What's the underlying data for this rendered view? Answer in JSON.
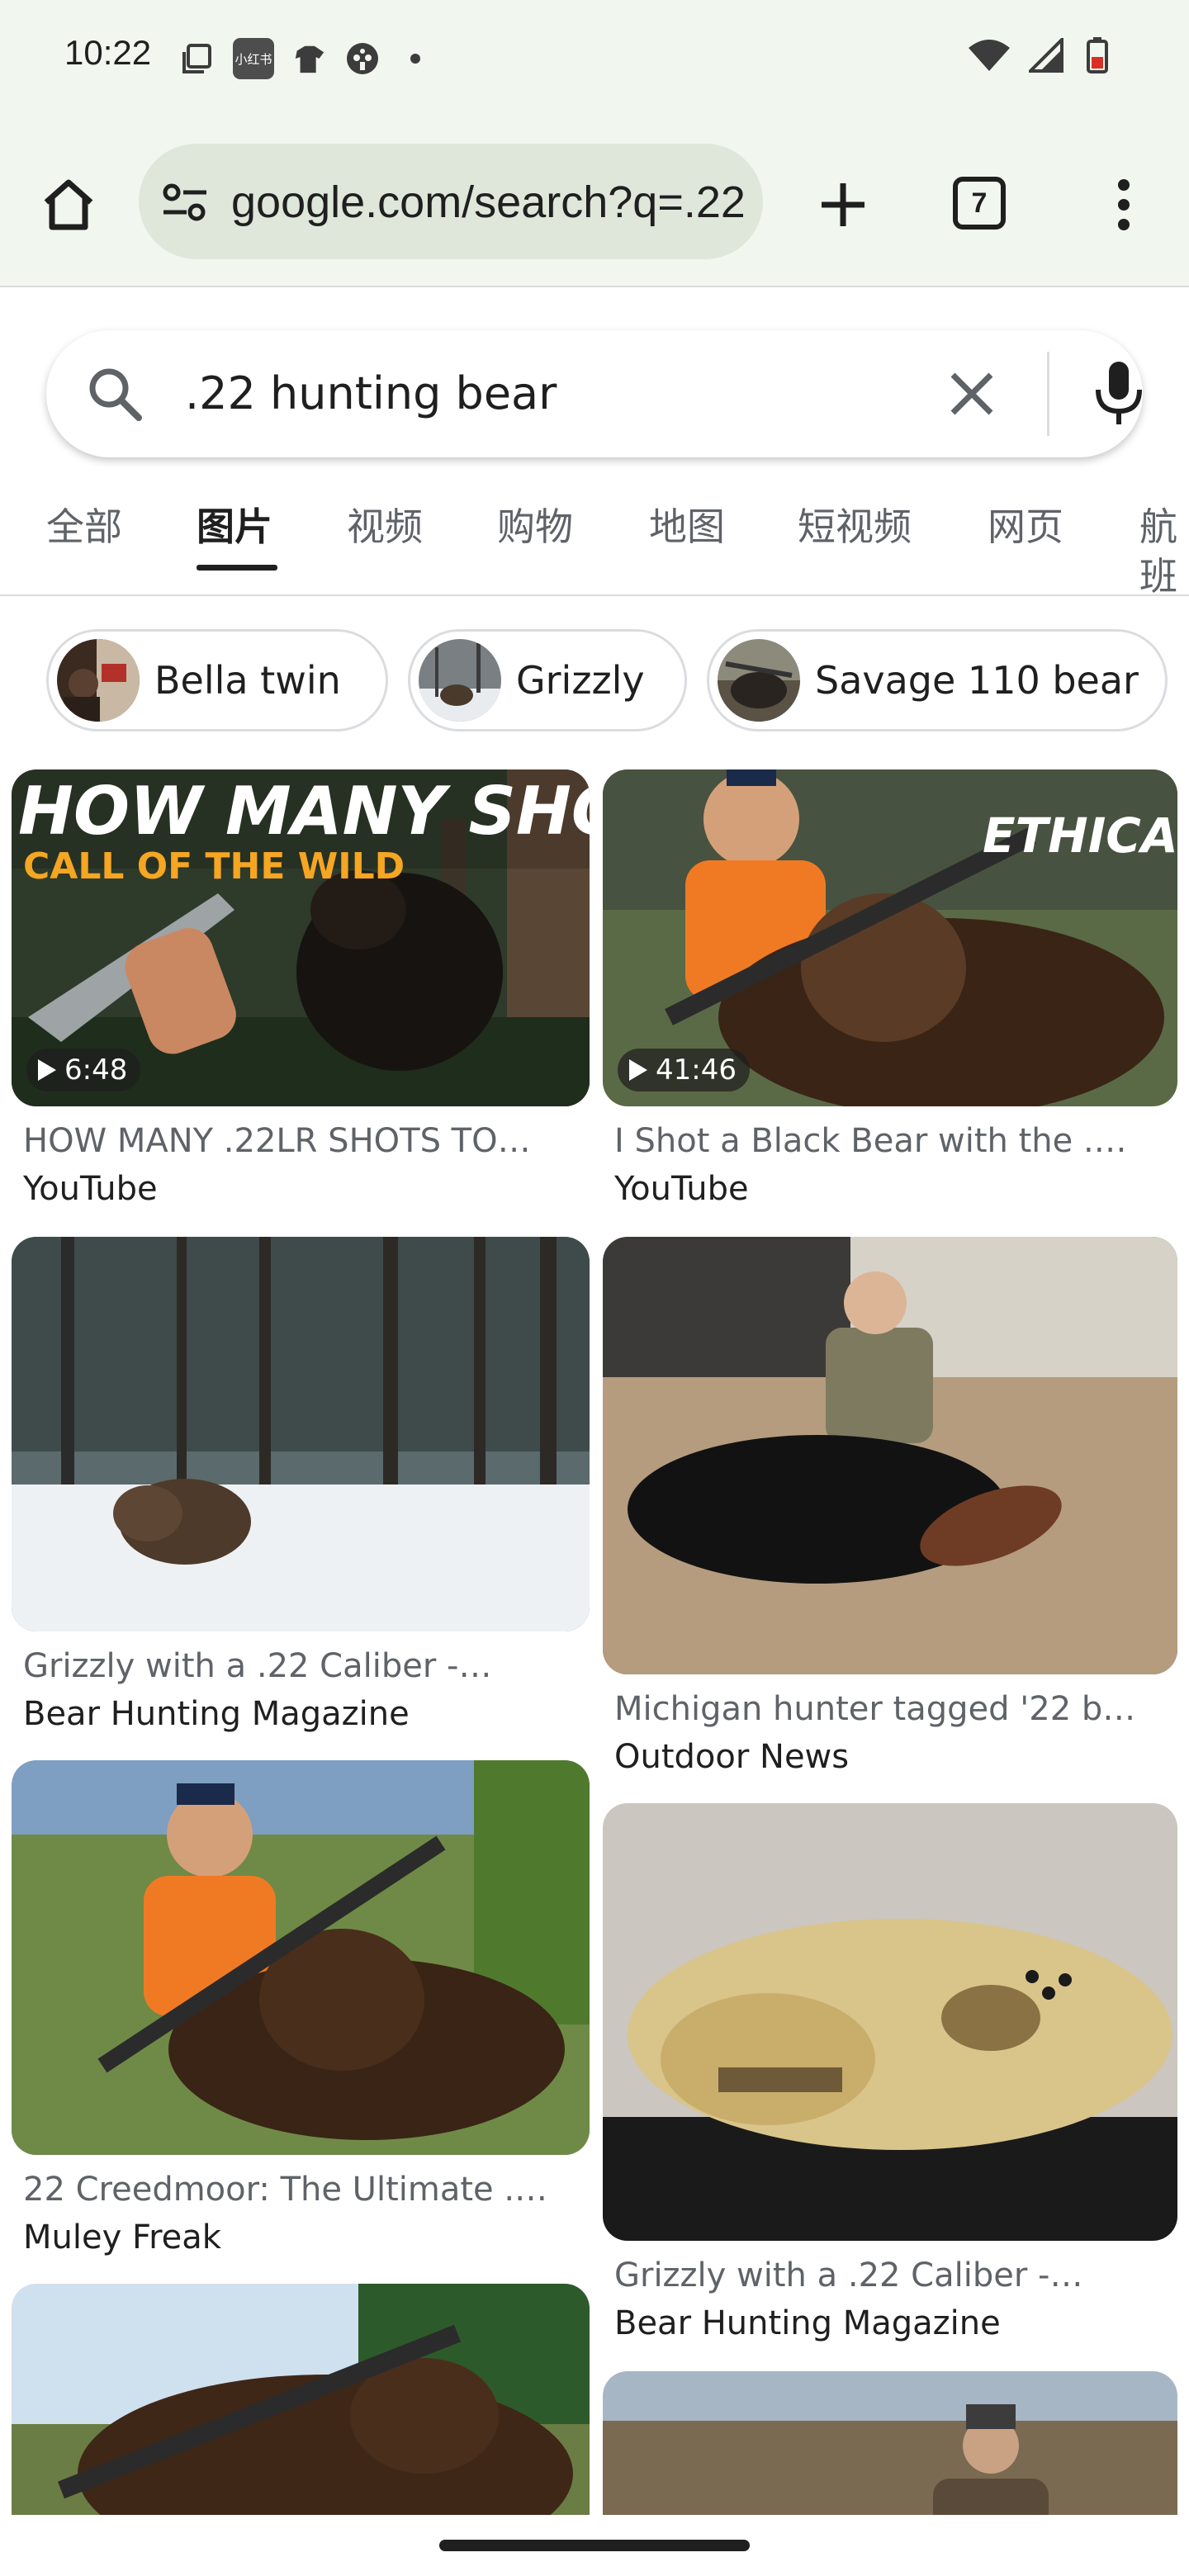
{
  "status_bar": {
    "time": "10:22",
    "app_badge_text": "小红书",
    "left_icons": [
      "screenshot-icon",
      "app-badge-icon",
      "shirt-icon",
      "game-controller-icon",
      "dot-icon"
    ],
    "right_icons": [
      "wifi-icon",
      "cellular-signal-icon",
      "battery-icon"
    ]
  },
  "toolbar": {
    "url": "google.com/search?q=.22",
    "tab_count": "7"
  },
  "search": {
    "query": ".22 hunting bear"
  },
  "tabs": [
    {
      "label": "全部"
    },
    {
      "label": "图片",
      "active": true
    },
    {
      "label": "视频"
    },
    {
      "label": "购物"
    },
    {
      "label": "地图"
    },
    {
      "label": "短视频"
    },
    {
      "label": "网页"
    },
    {
      "label": "航班"
    }
  ],
  "chips": [
    {
      "label": "Bella twin"
    },
    {
      "label": "Grizzly"
    },
    {
      "label": "Savage 110 bear"
    }
  ],
  "results": [
    {
      "title": "HOW MANY .22LR SHOTS TO…",
      "source": "YouTube",
      "duration": "6:48",
      "overlay_text": "HOW MANY SHOTS?",
      "overlay_sub": "CALL OF THE WILD"
    },
    {
      "title": "I Shot a Black Bear with the .2…",
      "source": "YouTube",
      "duration": "41:46",
      "overlay_text": "ETHICAL?"
    },
    {
      "title": "Grizzly with a .22 Caliber -…",
      "source": "Bear Hunting Magazine"
    },
    {
      "title": "Michigan hunter tagged '22 be…",
      "source": "Outdoor News"
    },
    {
      "title": "22 Creedmoor: The Ultimate .…",
      "source": "Muley Freak"
    },
    {
      "title": "Grizzly with a .22 Caliber -…",
      "source": "Bear Hunting Magazine"
    },
    {
      "title": "",
      "source": ""
    },
    {
      "title": "",
      "source": ""
    }
  ],
  "colors": {
    "chrome_bg": "#f1f7ee",
    "omnibox_bg": "#dfe6da",
    "text_primary": "#1f1f1f",
    "text_secondary": "#5f6368"
  }
}
